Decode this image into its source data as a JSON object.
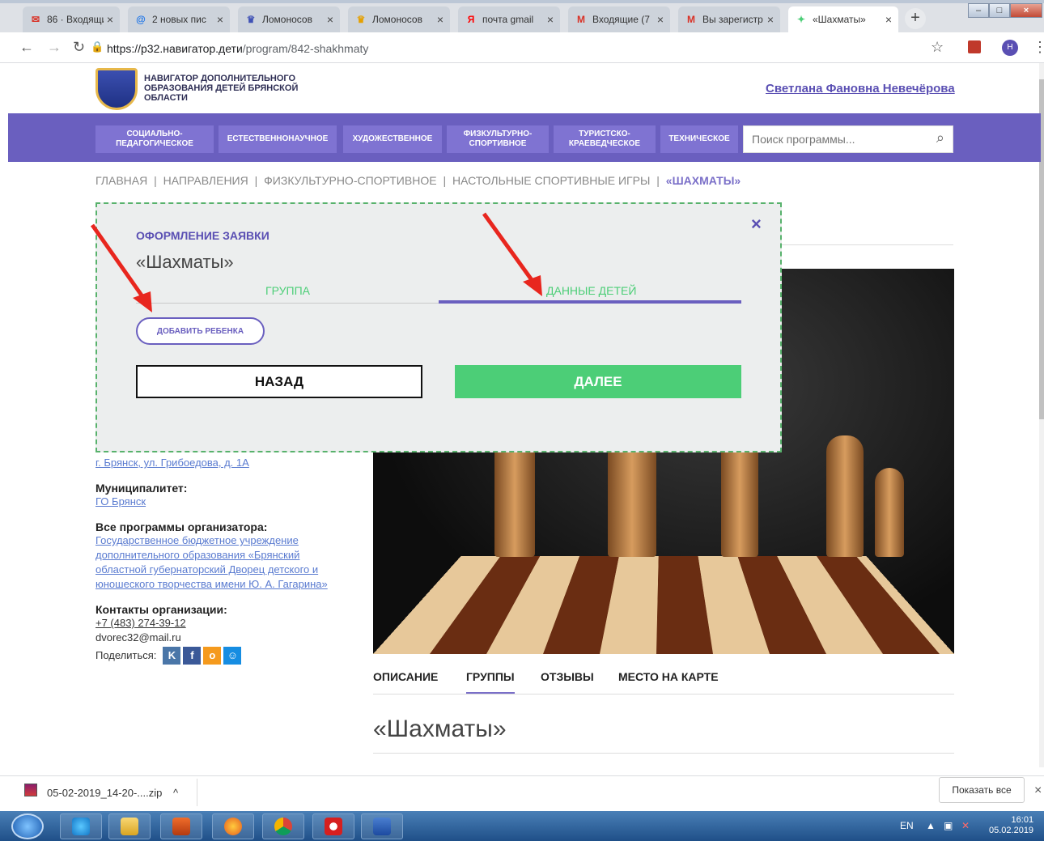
{
  "browser": {
    "tabs": [
      {
        "icon": "gmail-icon",
        "title": "86 · Входящи",
        "color": "#d93025"
      },
      {
        "icon": "mailru-icon",
        "title": "2 новых пис",
        "color": "#1a73e8"
      },
      {
        "icon": "lomonosov-icon",
        "title": "Ломоносов",
        "color": "#3f51b5"
      },
      {
        "icon": "lomonosov-icon",
        "title": "Ломоносов",
        "color": "#e5a000"
      },
      {
        "icon": "yandex-icon",
        "title": "почта gmail",
        "color": "#ff0000"
      },
      {
        "icon": "gmail-icon",
        "title": "Входящие (7",
        "color": "#d93025"
      },
      {
        "icon": "gmail-icon",
        "title": "Вы зарегистр",
        "color": "#d93025"
      },
      {
        "icon": "site-icon",
        "title": "«Шахматы»",
        "color": "#4cce77"
      }
    ],
    "url_host": "https://р32.навигатор.дети",
    "url_path": "/program/842-shakhmaty"
  },
  "header": {
    "logo_text": "НАВИГАТОР ДОПОЛНИТЕЛЬНОГО ОБРАЗОВАНИЯ ДЕТЕЙ БРЯНСКОЙ ОБЛАСТИ",
    "user_name": "Светлана Фановна Невечёрова"
  },
  "nav": {
    "items": [
      "СОЦИАЛЬНО-ПЕДАГОГИЧЕСКОЕ",
      "ЕСТЕСТВЕННОНАУЧНОЕ",
      "ХУДОЖЕСТВЕННОЕ",
      "ФИЗКУЛЬТУРНО-СПОРТИВНОЕ",
      "ТУРИСТСКО-КРАЕВЕДЧЕСКОЕ",
      "ТЕХНИЧЕСКОЕ"
    ],
    "search_placeholder": "Поиск программы..."
  },
  "breadcrumb": {
    "items": [
      "ГЛАВНАЯ",
      "|",
      "НАПРАВЛЕНИЯ",
      "|",
      "ФИЗКУЛЬТУРНО-СПОРТИВНОЕ",
      "|",
      "НАСТОЛЬНЫЕ СПОРТИВНЫЕ ИГРЫ",
      "|"
    ],
    "current": "«ШАХМАТЫ»"
  },
  "modal": {
    "heading": "ОФОРМЛЕНИЕ ЗАЯВКИ",
    "title": "«Шахматы»",
    "tab_group": "ГРУППА",
    "tab_children": "ДАННЫЕ ДЕТЕЙ",
    "add_child": "ДОБАВИТЬ РЕБЕНКА",
    "back": "НАЗАД",
    "next": "ДАЛЕЕ",
    "close": "×"
  },
  "info": {
    "address": "г. Брянск, ул. Грибоедова, д. 1А",
    "municipality_label": "Муниципалитет:",
    "municipality": "ГО Брянск",
    "organizer_label": "Все программы организатора:",
    "organizer": "Государственное бюджетное учреждение дополнительного образования «Брянский областной губернаторский Дворец детского и юношеского творчества имени Ю. А. Гагарина»",
    "contacts_label": "Контакты организации:",
    "phone": "+7 (483) 274-39-12",
    "email": "dvorec32@mail.ru",
    "share_label": "Поделиться:"
  },
  "program_tabs": [
    "ОПИСАНИЕ",
    "ГРУППЫ",
    "ОТЗЫВЫ",
    "МЕСТО НА КАРТЕ"
  ],
  "program_title": "«Шахматы»",
  "downloads": {
    "file": "05-02-2019_14-20-....zip",
    "chevron": "^",
    "show_all": "Показать все",
    "close": "×"
  },
  "taskbar": {
    "lang": "EN",
    "time": "16:01",
    "date": "05.02.2019"
  },
  "colors": {
    "brand": "#6a5fbf",
    "accent": "#4cce77",
    "arrow": "#e8261e"
  }
}
